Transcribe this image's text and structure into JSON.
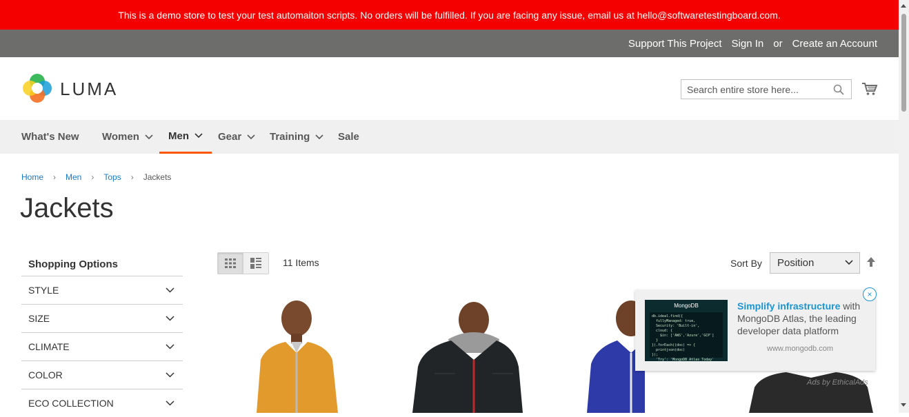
{
  "banner": {
    "text": "This is a demo store to test your test automaiton scripts. No orders will be fulfilled. If you are facing any issue, email us at hello@softwaretestingboard.com."
  },
  "header_links": {
    "support": "Support This Project",
    "sign_in": "Sign In",
    "or": "or",
    "create_account": "Create an Account"
  },
  "logo": {
    "text": "LUMA",
    "icon": "luma-logo-icon"
  },
  "search": {
    "placeholder": "Search entire store here...",
    "icon": "search-icon"
  },
  "cart": {
    "icon": "cart-icon"
  },
  "nav": {
    "items": [
      {
        "label": "What's New",
        "has_dropdown": false
      },
      {
        "label": "Women",
        "has_dropdown": true
      },
      {
        "label": "Men",
        "has_dropdown": true,
        "active": true
      },
      {
        "label": "Gear",
        "has_dropdown": true
      },
      {
        "label": "Training",
        "has_dropdown": true
      },
      {
        "label": "Sale",
        "has_dropdown": false
      }
    ],
    "accent_color": "#ff5501"
  },
  "breadcrumb": {
    "items": [
      "Home",
      "Men",
      "Tops"
    ],
    "current": "Jackets"
  },
  "page_title": "Jackets",
  "sidebar": {
    "title": "Shopping Options",
    "filters": [
      "STYLE",
      "SIZE",
      "CLIMATE",
      "COLOR",
      "ECO COLLECTION"
    ]
  },
  "toolbar": {
    "modes": [
      {
        "name": "grid",
        "active": true
      },
      {
        "name": "list",
        "active": false
      }
    ],
    "count": "11 Items",
    "sort_label": "Sort By",
    "sort_value": "Position",
    "sort_dir_icon": "arrow-up-icon"
  },
  "ad": {
    "image_brand": "MongoDB",
    "image_code": "db.ideal.find({\n  fullyManaged: true,\n  Security: 'Built-in',\n  cloud: {\n    $in: ['AWS','Azure','GCP']\n  }\n}).forEach((doc) => {\n  printjson(doc)\n});\n  'Try': 'MongoDB Atlas Today'",
    "headline": "Simplify infrastructure",
    "body": " with MongoDB Atlas, the leading developer data platform",
    "url": "www.mongodb.com",
    "close": "×",
    "credit": "Ads by EthicalAds",
    "accent_color": "#1a95d3"
  },
  "colors": {
    "banner": "#f40000",
    "topbar": "#6d6d6b",
    "link": "#1979c3"
  }
}
